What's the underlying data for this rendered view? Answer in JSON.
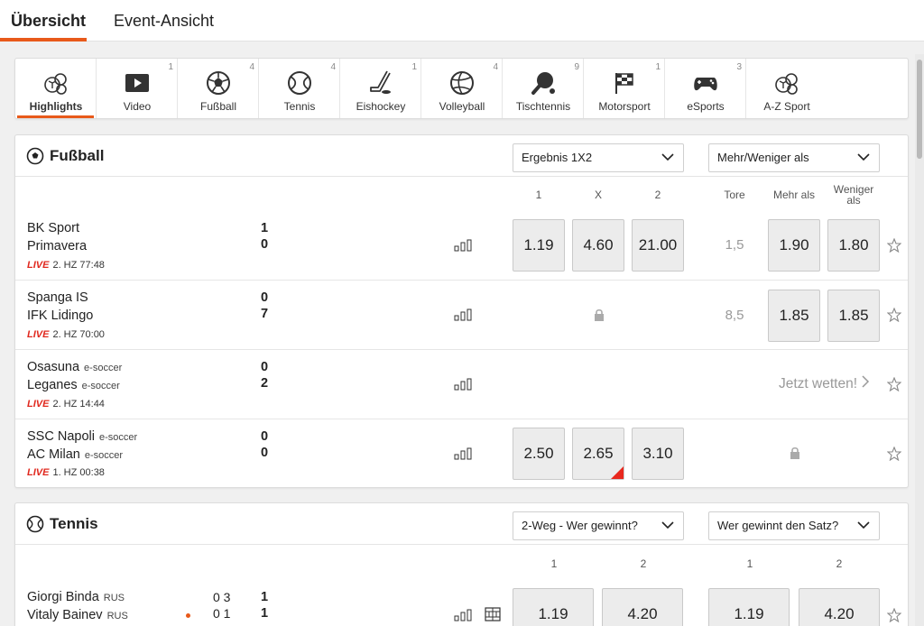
{
  "top_tabs": [
    {
      "label": "Übersicht",
      "active": true
    },
    {
      "label": "Event-Ansicht",
      "active": false
    }
  ],
  "sports": [
    {
      "label": "Highlights",
      "count": "",
      "icon": "multi-sport-icon",
      "active": true
    },
    {
      "label": "Video",
      "count": "1",
      "icon": "video-play-icon"
    },
    {
      "label": "Fußball",
      "count": "4",
      "icon": "soccer-ball-icon"
    },
    {
      "label": "Tennis",
      "count": "4",
      "icon": "tennis-ball-icon"
    },
    {
      "label": "Eishockey",
      "count": "1",
      "icon": "hockey-stick-icon"
    },
    {
      "label": "Volleyball",
      "count": "4",
      "icon": "volleyball-icon"
    },
    {
      "label": "Tischtennis",
      "count": "9",
      "icon": "table-tennis-icon"
    },
    {
      "label": "Motorsport",
      "count": "1",
      "icon": "checkered-flag-icon"
    },
    {
      "label": "eSports",
      "count": "3",
      "icon": "gamepad-icon"
    },
    {
      "label": "A-Z Sport",
      "count": "",
      "icon": "multi-sport-icon"
    }
  ],
  "football": {
    "title": "Fußball",
    "market1": "Ergebnis 1X2",
    "market2": "Mehr/Weniger als",
    "col_1": "1",
    "col_x": "X",
    "col_2": "2",
    "col_tore": "Tore",
    "col_mehr": "Mehr als",
    "col_weniger_1": "Weniger",
    "col_weniger_2": "als",
    "matches": [
      {
        "home": "BK Sport",
        "away": "Primavera",
        "home_tag": "",
        "away_tag": "",
        "live": "LIVE",
        "period": "2. HZ 77:48",
        "score_home": "1",
        "score_away": "0",
        "odd_1": "1.19",
        "odd_x": "4.60",
        "odd_2": "21.00",
        "tore": "1,5",
        "mehr": "1.90",
        "weniger": "1.80"
      },
      {
        "home": "Spanga IS",
        "away": "IFK Lidingo",
        "home_tag": "",
        "away_tag": "",
        "live": "LIVE",
        "period": "2. HZ 70:00",
        "score_home": "0",
        "score_away": "7",
        "tore": "8,5",
        "mehr": "1.85",
        "weniger": "1.85"
      },
      {
        "home": "Osasuna",
        "away": "Leganes",
        "home_tag": "e-soccer",
        "away_tag": "e-soccer",
        "live": "LIVE",
        "period": "2. HZ 14:44",
        "score_home": "0",
        "score_away": "2",
        "bet_now": "Jetzt wetten!"
      },
      {
        "home": "SSC Napoli",
        "away": "AC Milan",
        "home_tag": "e-soccer",
        "away_tag": "e-soccer",
        "live": "LIVE",
        "period": "1. HZ 00:38",
        "score_home": "0",
        "score_away": "0",
        "odd_1": "2.50",
        "odd_x": "2.65",
        "odd_2": "3.10"
      }
    ]
  },
  "tennis": {
    "title": "Tennis",
    "market1": "2-Weg - Wer gewinnt?",
    "market2": "Wer gewinnt den Satz?",
    "col_1": "1",
    "col_2": "2",
    "matches": [
      {
        "home": "Giorgi Binda",
        "away": "Vitaly Bainev",
        "home_tag": "RUS",
        "away_tag": "RUS",
        "games_home": "0 3",
        "games_away": "0 1",
        "sets_home": "1",
        "sets_away": "1",
        "odd_1": "1.19",
        "odd_2": "4.20",
        "set_1": "1.19",
        "set_2": "4.20"
      }
    ]
  },
  "colors": {
    "accent": "#e8591a",
    "live": "#e0281e",
    "odd_bg": "#ececec"
  }
}
